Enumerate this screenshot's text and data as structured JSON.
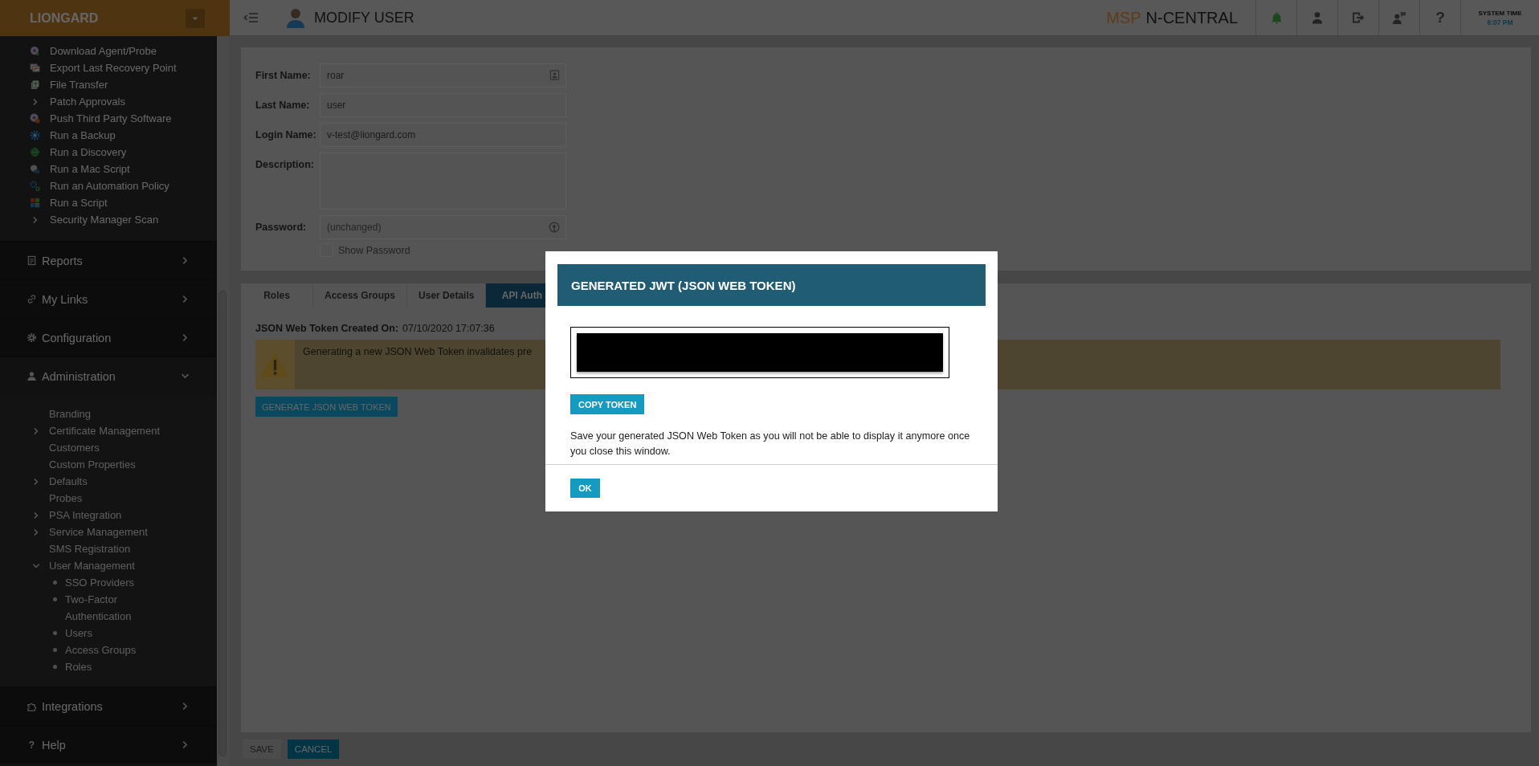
{
  "sidebar": {
    "brand": "LIONGARD",
    "actions": [
      {
        "label": "Download Agent/Probe",
        "kind": "action"
      },
      {
        "label": "Export Last Recovery Point",
        "kind": "action"
      },
      {
        "label": "File Transfer",
        "kind": "action"
      },
      {
        "label": "Patch Approvals",
        "kind": "group",
        "expanded": false
      },
      {
        "label": "Push Third Party Software",
        "kind": "action"
      },
      {
        "label": "Run a Backup",
        "kind": "action"
      },
      {
        "label": "Run a Discovery",
        "kind": "action"
      },
      {
        "label": "Run a Mac Script",
        "kind": "action"
      },
      {
        "label": "Run an Automation Policy",
        "kind": "action"
      },
      {
        "label": "Run a Script",
        "kind": "action"
      },
      {
        "label": "Security Manager Scan",
        "kind": "group",
        "expanded": false
      }
    ],
    "sections": [
      {
        "label": "Reports",
        "expanded": false
      },
      {
        "label": "My Links",
        "expanded": false
      },
      {
        "label": "Configuration",
        "expanded": false
      },
      {
        "label": "Administration",
        "expanded": true,
        "children": [
          {
            "label": "Branding",
            "kind": "link"
          },
          {
            "label": "Certificate Management",
            "kind": "group",
            "expanded": false
          },
          {
            "label": "Customers",
            "kind": "link"
          },
          {
            "label": "Custom Properties",
            "kind": "link"
          },
          {
            "label": "Defaults",
            "kind": "group",
            "expanded": false
          },
          {
            "label": "Probes",
            "kind": "link"
          },
          {
            "label": "PSA Integration",
            "kind": "group",
            "expanded": false
          },
          {
            "label": "Service Management",
            "kind": "group",
            "expanded": false
          },
          {
            "label": "SMS Registration",
            "kind": "link"
          },
          {
            "label": "User Management",
            "kind": "group",
            "expanded": true,
            "children": [
              {
                "label": "SSO Providers"
              },
              {
                "label": "Two-Factor Authentication"
              },
              {
                "label": "Users"
              },
              {
                "label": "Access Groups"
              },
              {
                "label": "Roles"
              }
            ]
          }
        ]
      },
      {
        "label": "Integrations",
        "expanded": false
      },
      {
        "label": "Help",
        "expanded": false,
        "glyph": "?"
      }
    ]
  },
  "header": {
    "title": "MODIFY USER",
    "brand_prefix": "MSP",
    "brand_name": "N-CENTRAL",
    "help_glyph": "?",
    "system_time_label": "SYSTEM TIME",
    "system_time": "6:07 PM"
  },
  "form": {
    "fields": [
      {
        "label": "First Name:",
        "kind": "text",
        "value": "roar"
      },
      {
        "label": "Last Name:",
        "kind": "text",
        "value": "user"
      },
      {
        "label": "Login Name:",
        "kind": "text",
        "value": "v-test@liongard.com"
      },
      {
        "label": "Description:",
        "kind": "textarea"
      },
      {
        "label": "Password:",
        "kind": "password",
        "placeholder": "(unchanged)"
      }
    ],
    "show_password": {
      "label": "Show Password",
      "checked": false
    }
  },
  "tabs": [
    {
      "label": "Roles",
      "selected": false
    },
    {
      "label": "Access Groups",
      "selected": false
    },
    {
      "label": "User Details",
      "selected": false
    },
    {
      "label": "API Auth",
      "selected": true
    }
  ],
  "token": {
    "created_label": "JSON Web Token Created On:",
    "created_value": "07/10/2020 17:07:36",
    "warning": "Generating a new JSON Web Token invalidates pre",
    "generate_button": "GENERATE JSON WEB TOKEN"
  },
  "footer_buttons": [
    {
      "label": "SAVE",
      "disabled": true
    },
    {
      "label": "CANCEL",
      "disabled": false
    }
  ],
  "modal": {
    "title": "GENERATED JWT (JSON WEB TOKEN)",
    "copy_button": "COPY TOKEN",
    "message": "Save your generated JSON Web Token as you will not be able to display it anymore once you close this window.",
    "ok_button": "OK"
  }
}
